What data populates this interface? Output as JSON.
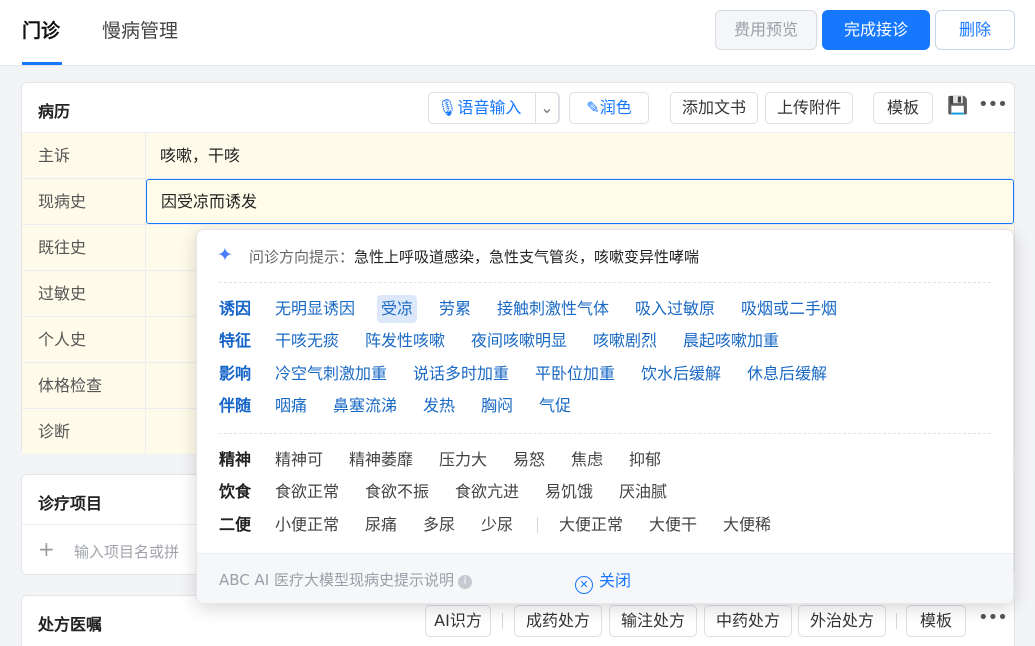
{
  "header": {
    "tabs": [
      "门诊",
      "慢病管理"
    ],
    "buttons": {
      "preview": "费用预览",
      "complete": "完成接诊",
      "delete": "删除"
    }
  },
  "record": {
    "title": "病历",
    "toolbar": {
      "voice": "语音输入",
      "polish": "润色",
      "add_doc": "添加文书",
      "upload": "上传附件",
      "template": "模板"
    },
    "rows": [
      {
        "label": "主诉",
        "value": "咳嗽，干咳"
      },
      {
        "label": "现病史",
        "value": "因受凉而诱发"
      },
      {
        "label": "既往史",
        "value": ""
      },
      {
        "label": "过敏史",
        "value": ""
      },
      {
        "label": "个人史",
        "value": ""
      },
      {
        "label": "体格检查",
        "value": ""
      },
      {
        "label": "诊断",
        "value": ""
      }
    ]
  },
  "popup": {
    "hint_prefix": "问诊方向提示：",
    "hint_text": "急性上呼吸道感染，急性支气管炎，咳嗽变异性哮喘",
    "groups_blue": [
      {
        "label": "诱因",
        "items": [
          "无明显诱因",
          "受凉",
          "劳累",
          "接触刺激性气体",
          "吸入过敏原",
          "吸烟或二手烟"
        ]
      },
      {
        "label": "特征",
        "items": [
          "干咳无痰",
          "阵发性咳嗽",
          "夜间咳嗽明显",
          "咳嗽剧烈",
          "晨起咳嗽加重"
        ]
      },
      {
        "label": "影响",
        "items": [
          "冷空气刺激加重",
          "说话多时加重",
          "平卧位加重",
          "饮水后缓解",
          "休息后缓解"
        ]
      },
      {
        "label": "伴随",
        "items": [
          "咽痛",
          "鼻塞流涕",
          "发热",
          "胸闷",
          "气促"
        ]
      }
    ],
    "selected": "受凉",
    "groups_gray": [
      {
        "label": "精神",
        "items": [
          "精神可",
          "精神萎靡",
          "压力大",
          "易怒",
          "焦虑",
          "抑郁"
        ]
      },
      {
        "label": "饮食",
        "items": [
          "食欲正常",
          "食欲不振",
          "食欲亢进",
          "易饥饿",
          "厌油腻"
        ]
      },
      {
        "label": "二便",
        "items": [
          "小便正常",
          "尿痛",
          "多尿",
          "少尿",
          "大便正常",
          "大便干",
          "大便稀"
        ]
      }
    ],
    "footer_note": "ABC AI 医疗大模型现病史提示说明",
    "close_label": "关闭"
  },
  "items_card": {
    "title": "诊疗项目",
    "input_placeholder": "输入项目名或拼"
  },
  "rx_card": {
    "title": "处方医嘱",
    "buttons": [
      "AI识方",
      "成药处方",
      "输注处方",
      "中药处方",
      "外治处方"
    ],
    "template": "模板"
  },
  "colors": {
    "accent": "#1677ff",
    "tag_blue": "#1a69c4",
    "row_bg": "#fffbea"
  }
}
